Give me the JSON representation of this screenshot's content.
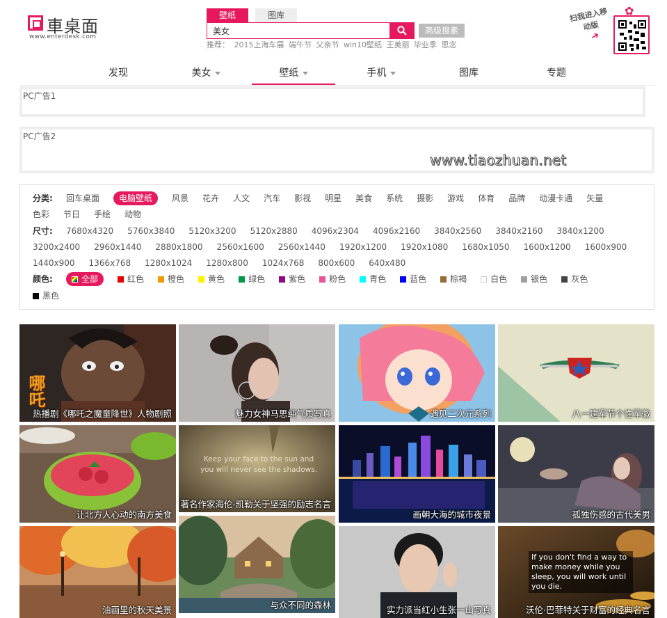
{
  "logo": {
    "text": "車桌面",
    "sub": "www.enterdesk.com"
  },
  "search": {
    "tabs": [
      "壁纸",
      "图库"
    ],
    "value": "美女",
    "advanced_label": "高级搜素",
    "hot_label": "推荐：",
    "hot_words": [
      "2015上海车展",
      "端午节",
      "父亲节",
      "win10壁纸",
      "王美丽",
      "毕业季",
      "思念"
    ]
  },
  "qr": {
    "text": "扫我进入移动版"
  },
  "nav": [
    {
      "label": "发现",
      "caret": false
    },
    {
      "label": "美女",
      "caret": true
    },
    {
      "label": "壁纸",
      "caret": true
    },
    {
      "label": "手机",
      "caret": true
    },
    {
      "label": "图库",
      "caret": false
    },
    {
      "label": "专题",
      "caret": false
    }
  ],
  "ads": {
    "ad1": "PC广告1",
    "ad2": "PC广告2",
    "watermark": "www.tiaozhuan.net"
  },
  "filter": {
    "category_label": "分类:",
    "categories": [
      "回车桌面",
      "电脑壁纸",
      "风景",
      "花卉",
      "人文",
      "汽车",
      "影视",
      "明星",
      "美食",
      "系统",
      "摄影",
      "游戏",
      "体育",
      "品牌",
      "动漫卡通",
      "矢量",
      "色彩",
      "节日",
      "手绘",
      "动物"
    ],
    "size_label": "尺寸:",
    "sizes": [
      "7680x4320",
      "5760x3840",
      "5120x3200",
      "5120x2880",
      "4096x2304",
      "4096x2160",
      "3840x2560",
      "3840x2160",
      "3840x1200",
      "3200x2400",
      "2960x1440",
      "2880x1800",
      "2560x1600",
      "2560x1440",
      "1920x1200",
      "1920x1080",
      "1680x1050",
      "1600x1200",
      "1600x900",
      "1440x900",
      "1366x768",
      "1280x1024",
      "1280x800",
      "1024x768",
      "800x600",
      "640x480"
    ],
    "color_label": "颜色:",
    "colors": [
      {
        "name": "全部",
        "hex": "multi"
      },
      {
        "name": "红色",
        "hex": "#e60000"
      },
      {
        "name": "橙色",
        "hex": "#f39800"
      },
      {
        "name": "黄色",
        "hex": "#fff100"
      },
      {
        "name": "绿色",
        "hex": "#009944"
      },
      {
        "name": "紫色",
        "hex": "#920783"
      },
      {
        "name": "粉色",
        "hex": "#e85298"
      },
      {
        "name": "青色",
        "hex": "#00ffff"
      },
      {
        "name": "蓝色",
        "hex": "#0000ff"
      },
      {
        "name": "棕褐",
        "hex": "#996c33"
      },
      {
        "name": "白色",
        "hex": "#ffffff"
      },
      {
        "name": "银色",
        "hex": "#a0a0a0"
      },
      {
        "name": "灰色",
        "hex": "#444444"
      },
      {
        "name": "黑色",
        "hex": "#000000"
      }
    ]
  },
  "thumbs": [
    "热播剧《哪吒之魔童降世》人物剧照",
    "魅力女神马思纯气质写真",
    "遇见二次元系列",
    "八一建军节个性军徽",
    "让北方人心动的南方美食",
    "著名作家海伦·凯勒关于坚强的励志名言",
    "画朝大海的城市夜景",
    "孤独伤感的古代美男",
    "油画里的秋天美景",
    "与众不同的森林",
    "实力派当红小生张一山写真",
    "沃伦·巴菲特关于财富的经典名言"
  ],
  "thumb_texts": {
    "quote1": "Keep your face to the sun and you will never see the shadows.",
    "quote2": "If you don't find a way to make money while you sleep, you will work until you die.",
    "nezha_logo": "哪吒"
  }
}
